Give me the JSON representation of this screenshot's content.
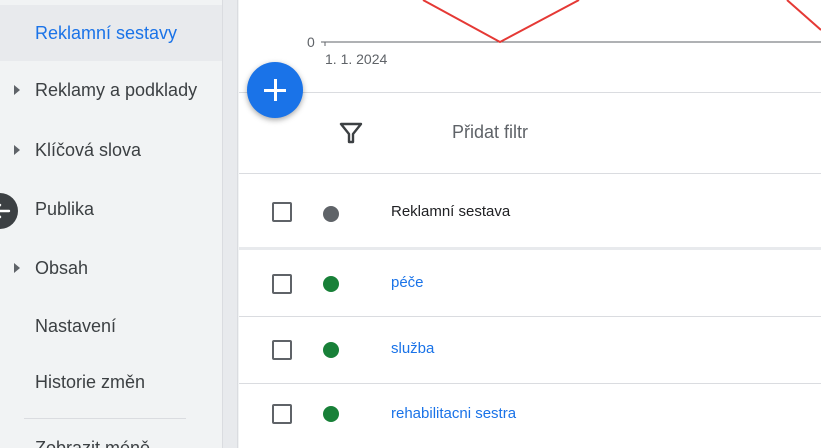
{
  "sidebar": {
    "items": [
      {
        "label": "Reklamní sestavy",
        "active": true,
        "expandable": false
      },
      {
        "label": "Reklamy a podklady",
        "active": false,
        "expandable": true
      },
      {
        "label": "Klíčová slova",
        "active": false,
        "expandable": true
      },
      {
        "label": "Publika",
        "active": false,
        "expandable": false
      },
      {
        "label": "Obsah",
        "active": false,
        "expandable": true
      },
      {
        "label": "Nastavení",
        "active": false,
        "expandable": false
      },
      {
        "label": "Historie změn",
        "active": false,
        "expandable": false
      }
    ],
    "cut_item": "Zobrazit méně",
    "collapse_icon": "chevron-left-icon"
  },
  "chart": {
    "y_zero_label": "0",
    "x_start_label": "1. 1. 2024",
    "line_color": "#e53935"
  },
  "fab": {
    "icon": "plus-icon",
    "color": "#1a73e8"
  },
  "filter": {
    "label": "Přidat filtr",
    "icon": "filter-icon"
  },
  "table": {
    "header": {
      "label": "Reklamní sestava",
      "status_color": "#5f6368"
    },
    "rows": [
      {
        "name": "péče",
        "status_color": "#188038"
      },
      {
        "name": "služba",
        "status_color": "#188038"
      },
      {
        "name": "rehabilitacni sestra",
        "status_color": "#188038"
      }
    ]
  }
}
